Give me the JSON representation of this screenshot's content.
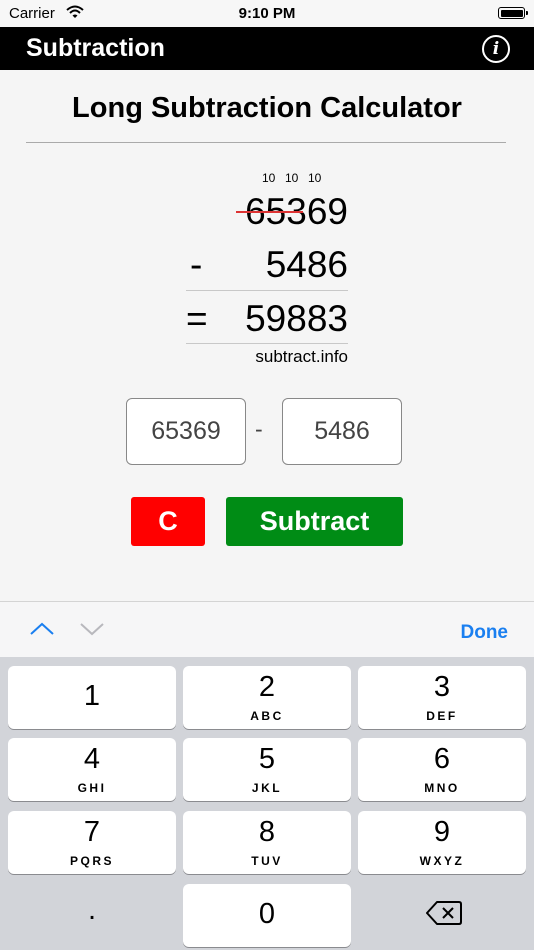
{
  "status": {
    "carrier": "Carrier",
    "time": "9:10 PM"
  },
  "nav": {
    "title": "Subtraction"
  },
  "page": {
    "title": "Long Subtraction Calculator"
  },
  "work": {
    "borrows": [
      "10",
      "10",
      "10"
    ],
    "minuend": "65369",
    "operator": "-",
    "subtrahend": "5486",
    "equals": "=",
    "result": "59883",
    "website": "subtract.info"
  },
  "inputs": {
    "a_value": "65369",
    "operator": "-",
    "b_value": "5486"
  },
  "buttons": {
    "clear": "C",
    "subtract": "Subtract"
  },
  "toolbar": {
    "done": "Done"
  },
  "keyboard": {
    "keys": [
      {
        "num": "1",
        "letters": ""
      },
      {
        "num": "2",
        "letters": "ABC"
      },
      {
        "num": "3",
        "letters": "DEF"
      },
      {
        "num": "4",
        "letters": "GHI"
      },
      {
        "num": "5",
        "letters": "JKL"
      },
      {
        "num": "6",
        "letters": "MNO"
      },
      {
        "num": "7",
        "letters": "PQRS"
      },
      {
        "num": "8",
        "letters": "TUV"
      },
      {
        "num": "9",
        "letters": "WXYZ"
      }
    ],
    "dot": ".",
    "zero": "0"
  },
  "colors": {
    "clear": "#ff0000",
    "subtract": "#008c15",
    "accent": "#1a7ff0",
    "strike": "#d33333"
  }
}
